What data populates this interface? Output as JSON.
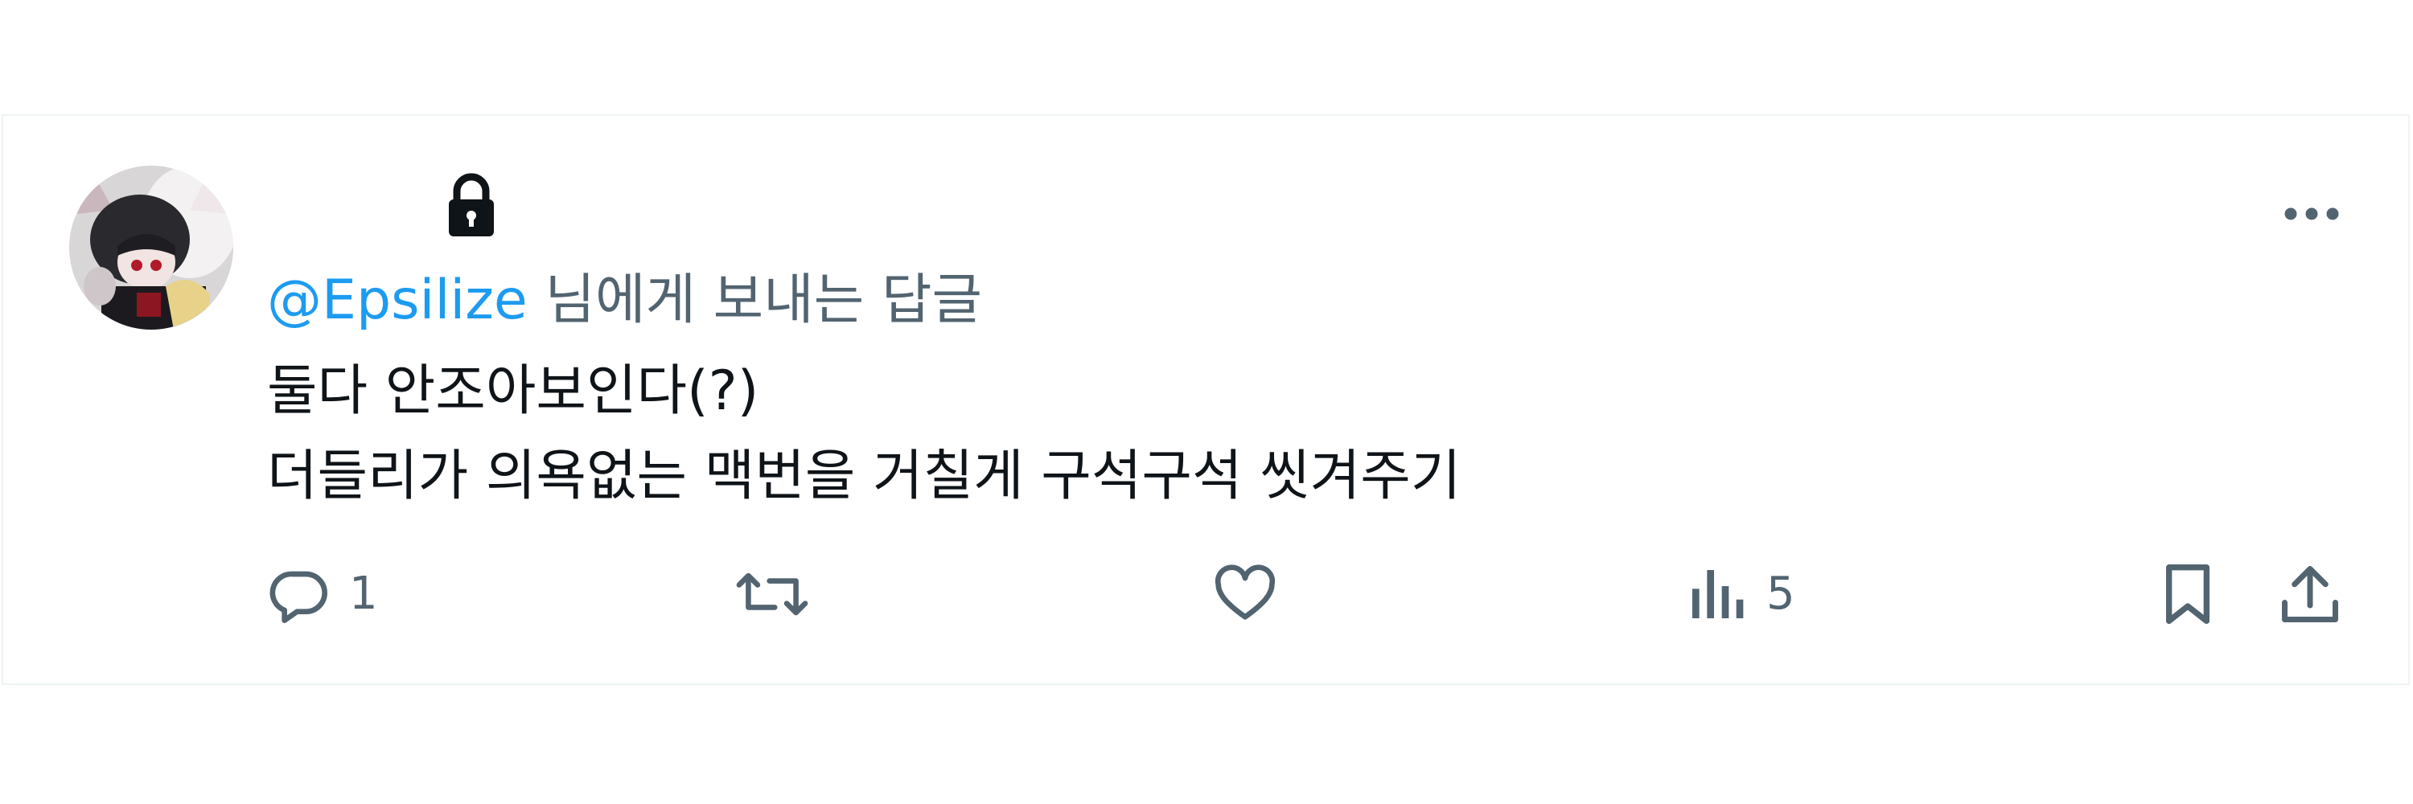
{
  "reply": {
    "handle": "@Epsilize",
    "suffix": "님에게 보내는 답글"
  },
  "tweet": {
    "lines": [
      "둘다 안조아보인다(?)",
      "더들리가 의욕없는 맥번을 거칠게 구석구석 씻겨주기"
    ]
  },
  "actions": {
    "reply_count": "1",
    "views_count": "5"
  },
  "icons": {
    "lock": "lock-icon",
    "more": "more-horizontal-icon",
    "reply": "reply-icon",
    "retweet": "retweet-icon",
    "like": "heart-icon",
    "views": "analytics-icon",
    "bookmark": "bookmark-icon",
    "share": "share-icon"
  },
  "colors": {
    "handle": "#1d9bf0",
    "secondary_text": "#536471",
    "text": "#0f1419",
    "border": "#eff3f4"
  }
}
